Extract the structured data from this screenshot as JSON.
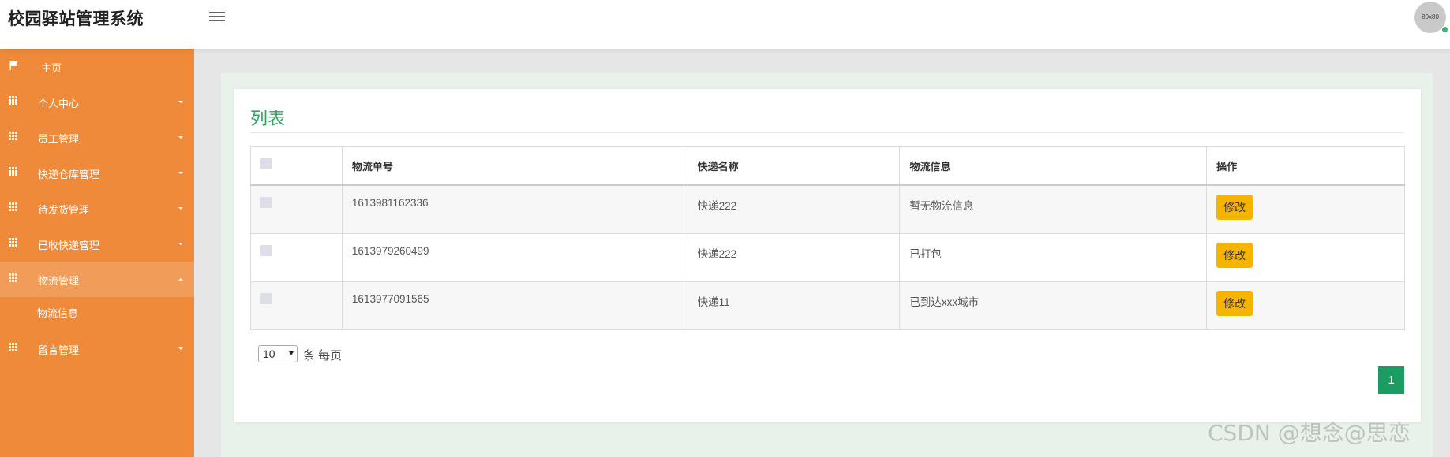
{
  "app": {
    "title": "校园驿站管理系统"
  },
  "header": {
    "avatar_text": "80x80"
  },
  "sidebar": {
    "items": [
      {
        "label": "主页",
        "icon": "flag-icon"
      },
      {
        "label": "个人中心",
        "icon": "grid-icon"
      },
      {
        "label": "员工管理",
        "icon": "grid-icon"
      },
      {
        "label": "快递仓库管理",
        "icon": "grid-icon"
      },
      {
        "label": "待发货管理",
        "icon": "grid-icon"
      },
      {
        "label": "已收快递管理",
        "icon": "grid-icon"
      },
      {
        "label": "物流管理",
        "icon": "grid-icon",
        "expanded": true
      },
      {
        "label": "留言管理",
        "icon": "grid-icon"
      }
    ],
    "sub_items": [
      {
        "label": "物流信息"
      }
    ]
  },
  "main": {
    "title": "列表",
    "table": {
      "columns": [
        "物流单号",
        "快递名称",
        "物流信息",
        "操作"
      ],
      "rows": [
        {
          "tracking_no": "1613981162336",
          "courier": "快递222",
          "info": "暂无物流信息",
          "action": "修改"
        },
        {
          "tracking_no": "1613979260499",
          "courier": "快递222",
          "info": "已打包",
          "action": "修改"
        },
        {
          "tracking_no": "1613977091565",
          "courier": "快递11",
          "info": "已到达xxx城市",
          "action": "修改"
        }
      ]
    },
    "pagination": {
      "page_size": "10",
      "page_size_suffix": "条 每页",
      "current_page": "1"
    }
  },
  "watermark": "CSDN @想念@思恋",
  "colors": {
    "sidebar": "#ef8a3b",
    "accent_green": "#2fa35f",
    "edit_button": "#f5b400",
    "page_button": "#1b9d61"
  }
}
